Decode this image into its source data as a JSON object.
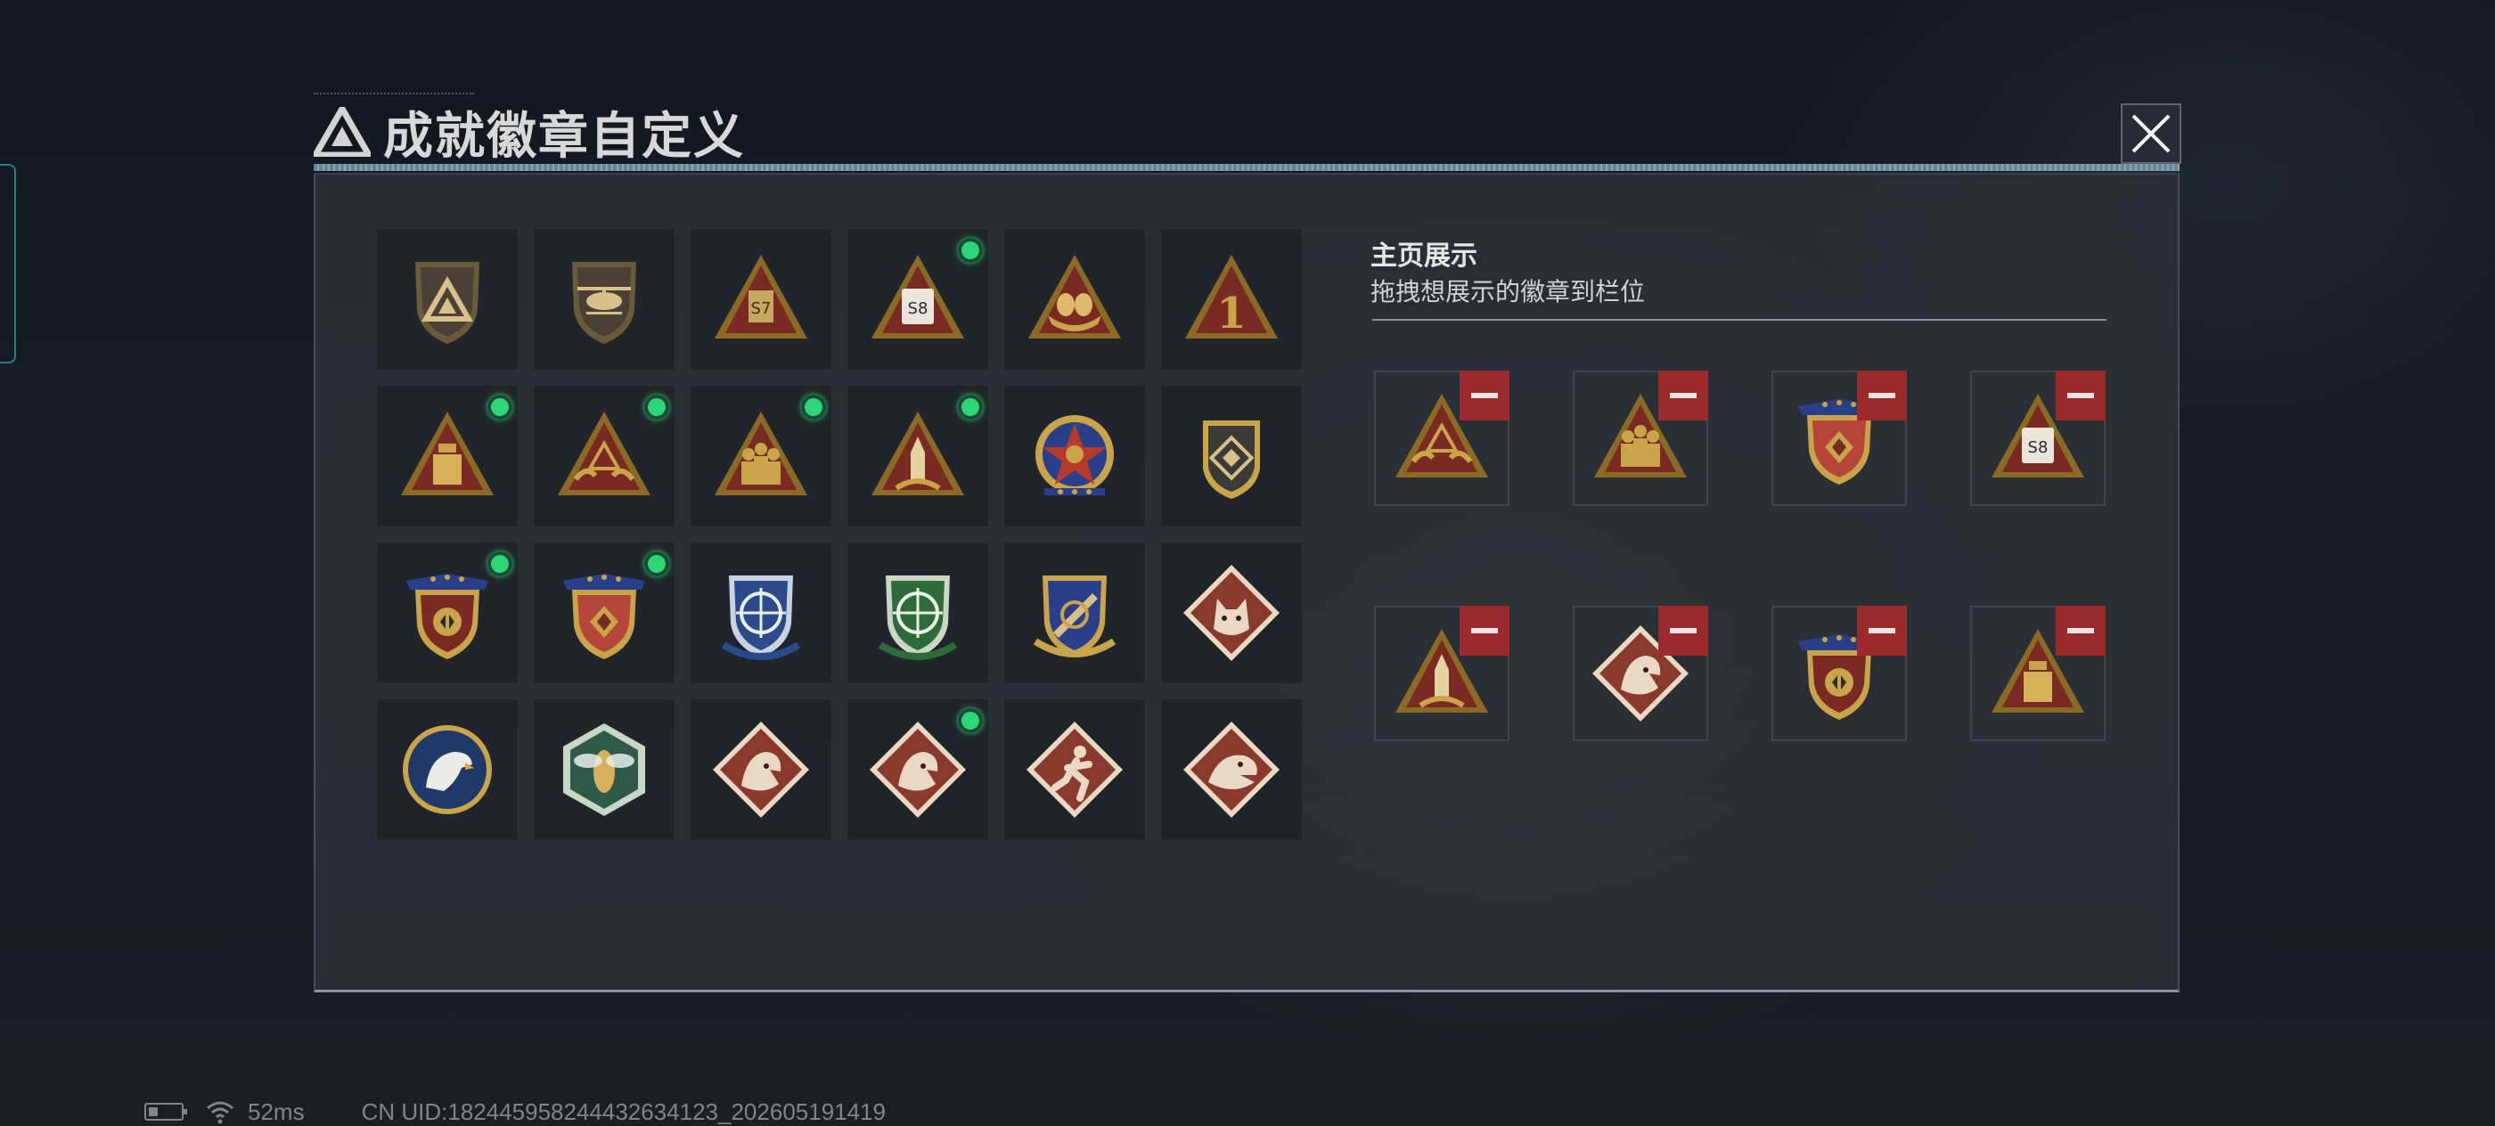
{
  "header": {
    "title": "成就徽章自定义",
    "logo_icon": "triangle-logo-icon",
    "close_icon": "close-x-icon"
  },
  "badges": {
    "rows": [
      [
        {
          "name": "shield-triangle-badge",
          "new": false
        },
        {
          "name": "helicopter-shield-badge",
          "new": false
        },
        {
          "name": "triangle-s7-badge",
          "new": false
        },
        {
          "name": "triangle-s8-badge",
          "new": true
        },
        {
          "name": "triangle-eggs-badge",
          "new": false
        },
        {
          "name": "triangle-number-one-badge",
          "new": false
        }
      ],
      [
        {
          "name": "triangle-tower-badge",
          "new": true
        },
        {
          "name": "triangle-hands-badge",
          "new": true
        },
        {
          "name": "triangle-soldiers-badge",
          "new": true
        },
        {
          "name": "triangle-rocket-badge",
          "new": true
        },
        {
          "name": "star-medal-badge",
          "new": false
        },
        {
          "name": "shield-emblem-badge",
          "new": false
        }
      ],
      [
        {
          "name": "gold-shield-banner-badge",
          "new": true
        },
        {
          "name": "red-shield-banner-badge",
          "new": true
        },
        {
          "name": "blue-crosshair-shield-badge",
          "new": false
        },
        {
          "name": "green-crosshair-shield-badge",
          "new": false
        },
        {
          "name": "gold-missile-shield-badge",
          "new": false
        },
        {
          "name": "wolf-diamond-badge",
          "new": false
        }
      ],
      [
        {
          "name": "eagle-circle-badge",
          "new": false
        },
        {
          "name": "hornet-hexagon-badge",
          "new": false
        },
        {
          "name": "dragon-diamond-badge",
          "new": false
        },
        {
          "name": "dragon-diamond-badge-2",
          "new": true
        },
        {
          "name": "runner-diamond-badge",
          "new": false
        },
        {
          "name": "crocodile-diamond-badge",
          "new": false
        }
      ]
    ]
  },
  "showcase": {
    "title": "主页展示",
    "subtitle": "拖拽想展示的徽章到栏位",
    "remove_icon": "minus-icon",
    "slots": [
      {
        "badge": "triangle-hands-badge"
      },
      {
        "badge": "triangle-soldiers-badge"
      },
      {
        "badge": "red-shield-banner-badge"
      },
      {
        "badge": "triangle-s8-badge"
      },
      {
        "badge": "triangle-rocket-badge"
      },
      {
        "badge": "dragon-diamond-badge"
      },
      {
        "badge": "gold-shield-banner-badge"
      },
      {
        "badge": "triangle-tower-badge"
      }
    ]
  },
  "status_bar": {
    "battery_icon": "battery-icon",
    "wifi_icon": "wifi-icon",
    "ping": "52ms",
    "uid": "CN UID:1824459582444326341​23_202605191419"
  },
  "colors": {
    "gold": "#c9a44a",
    "badge_red": "#7a2a22",
    "new_dot": "#2fd677",
    "remove_red": "#9c2a2c"
  }
}
